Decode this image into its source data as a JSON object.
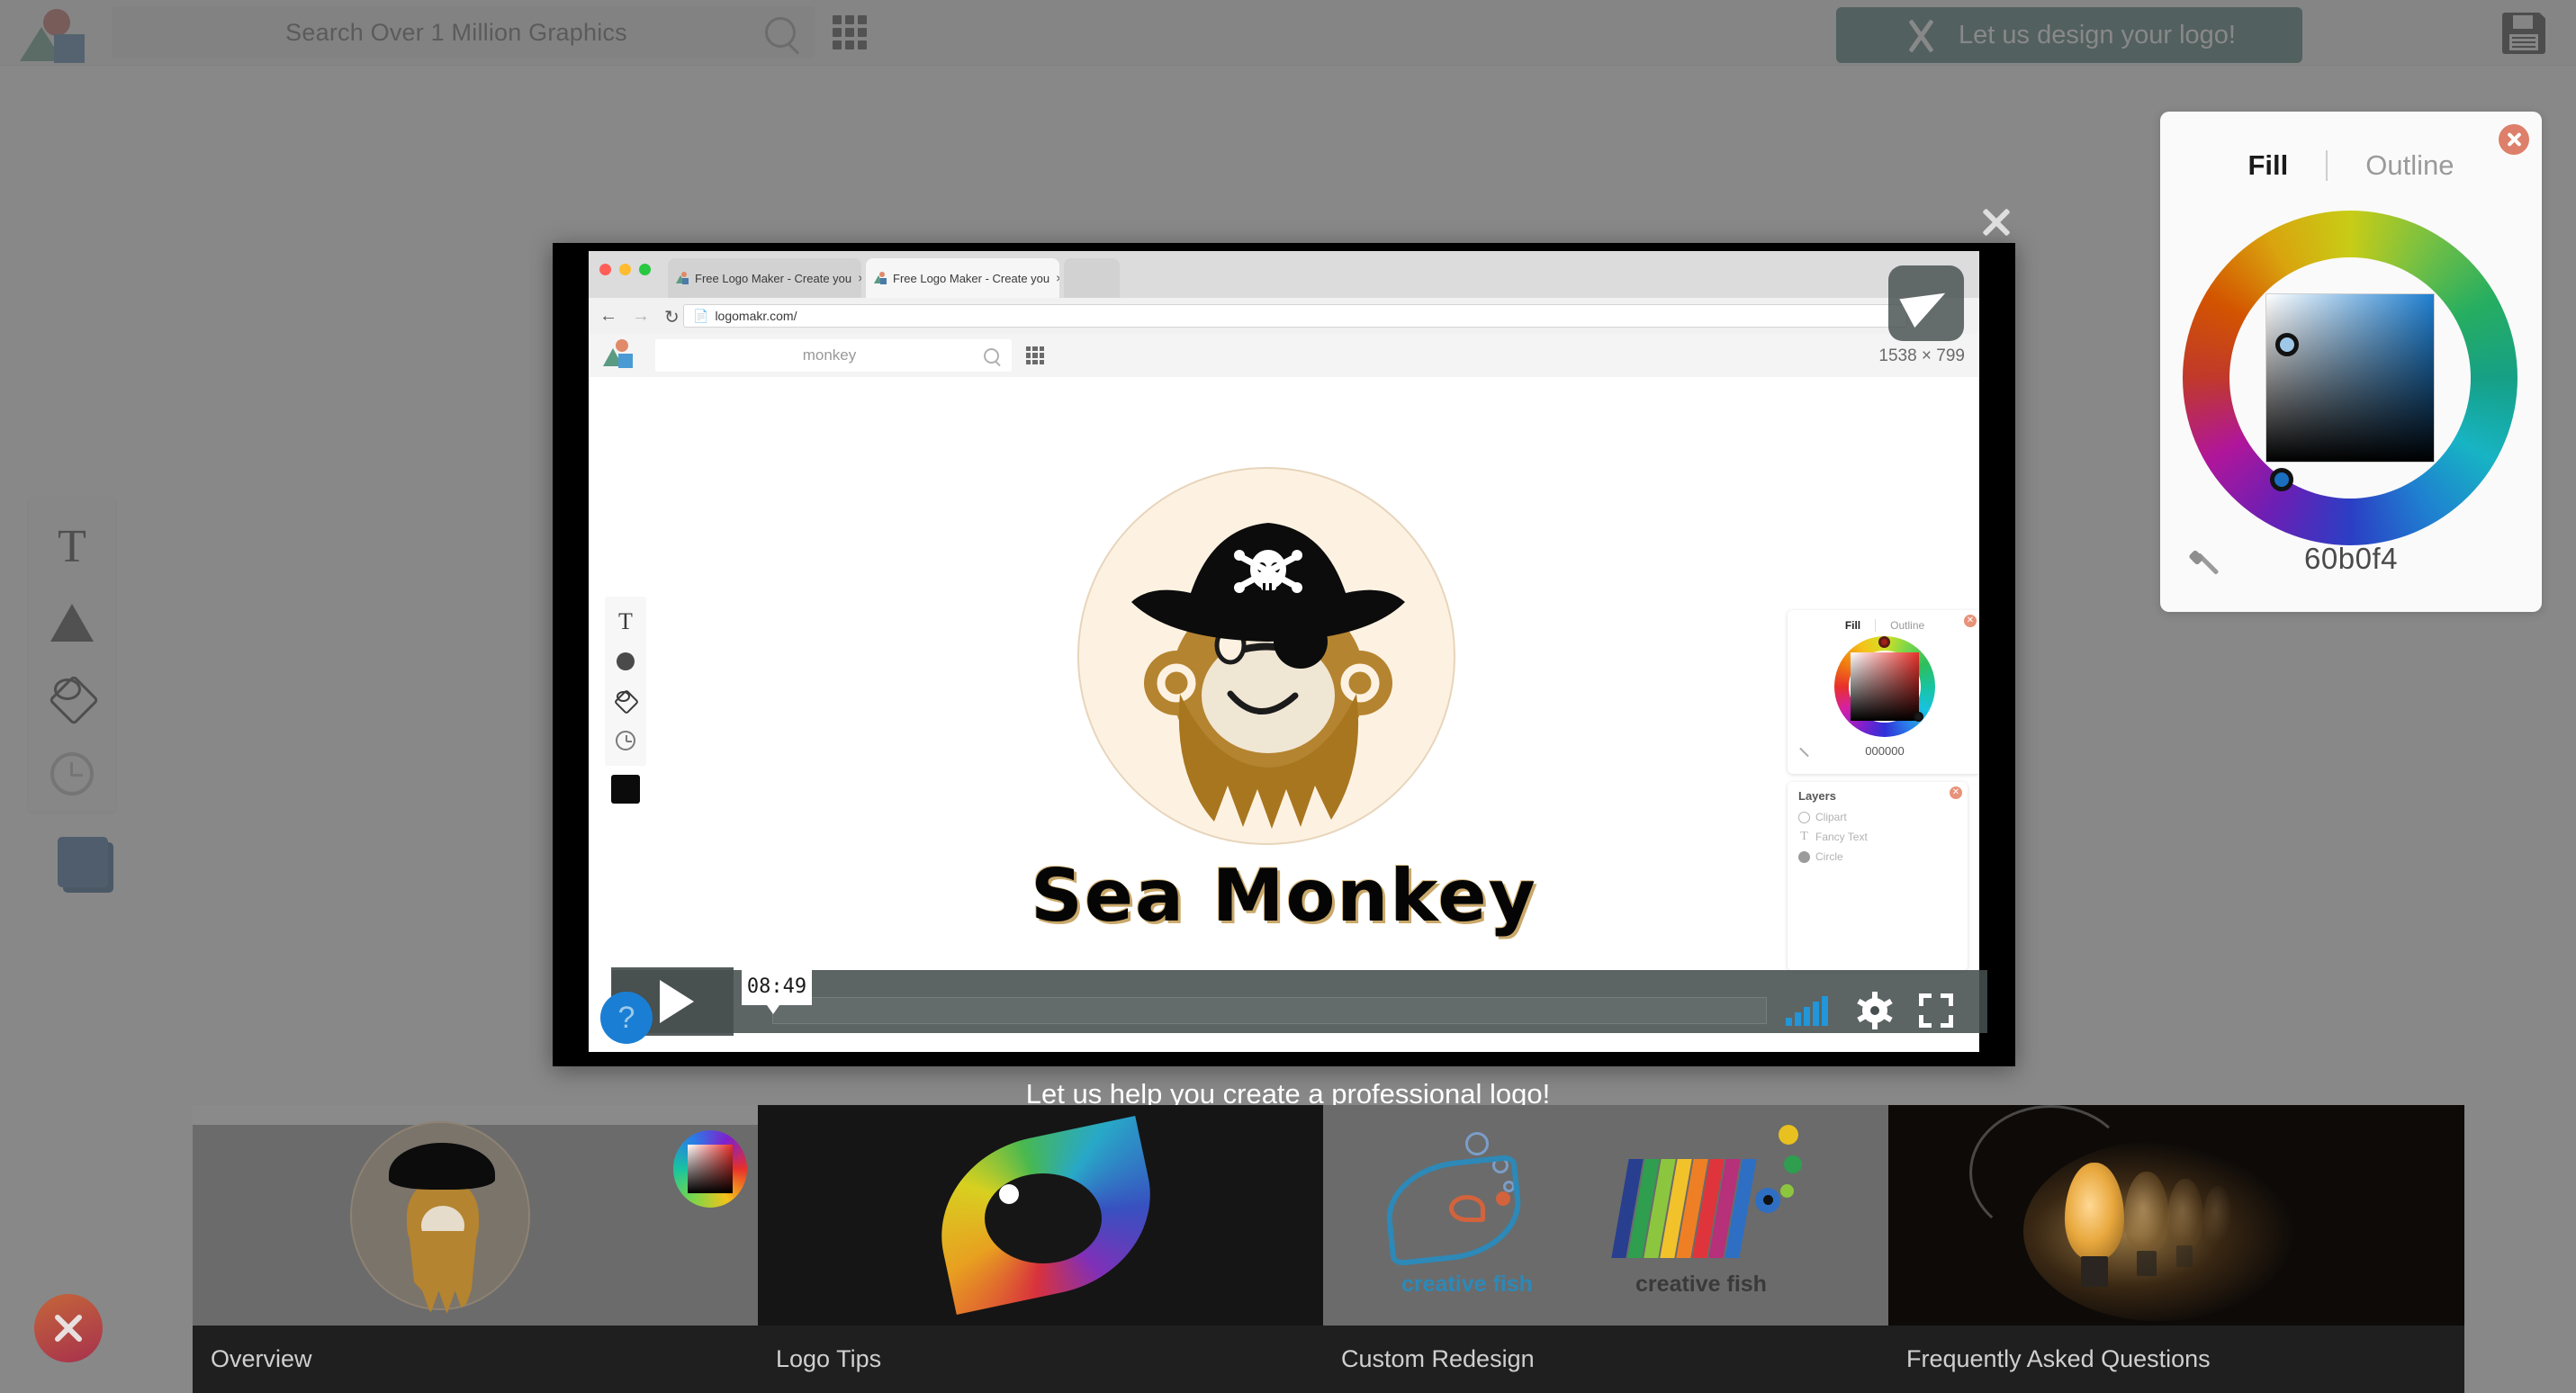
{
  "app": {
    "name": "Logo Maker"
  },
  "topbar": {
    "search_placeholder": "Search Over 1 Million Graphics",
    "search_value": "",
    "grid_icon": "grid-icon",
    "search_icon": "search-icon",
    "design_button_label": "Let us design your logo!",
    "design_button_icon": "pencil-icon",
    "design_button_color": "#3f6f6e",
    "save_icon": "save-floppy-icon",
    "logo_icon": "app-logo-shapes-icon"
  },
  "left_toolbar": {
    "items": [
      {
        "name": "text-tool",
        "icon": "text-T-icon",
        "label": "Text"
      },
      {
        "name": "shape-tool",
        "icon": "triangle-icon",
        "label": "Shape"
      },
      {
        "name": "clipart-tool",
        "icon": "clipart-icon",
        "label": "Clipart"
      },
      {
        "name": "history-tool",
        "icon": "history-clock-icon",
        "label": "History"
      }
    ],
    "swatch_color": "#336699"
  },
  "close_button": {
    "icon": "close-x-icon",
    "label": "Close"
  },
  "color_panel": {
    "tab_fill": "Fill",
    "tab_outline": "Outline",
    "active_tab": "Fill",
    "hex_value": "60b0f4",
    "close_icon": "close-circle-icon",
    "eyedropper_icon": "eyedropper-icon",
    "wheel_icon": "color-wheel",
    "selected_color": "#60b0f4"
  },
  "video_modal": {
    "close_icon": "close-x-icon",
    "send_icon": "paper-plane-icon",
    "browser": {
      "tabs": [
        {
          "title": "Free Logo Maker - Create you",
          "close": "×"
        },
        {
          "title": "Free Logo Maker - Create you",
          "close": "×"
        }
      ],
      "nav": {
        "back": "←",
        "forward": "→",
        "reload": "↻"
      },
      "url": "logomakr.com/",
      "url_icon": "page-icon",
      "traffic_lights": [
        "#ff5f57",
        "#febc2e",
        "#28c840"
      ]
    },
    "inner_app": {
      "search_value": "monkey",
      "search_icon": "search-icon",
      "grid_icon": "grid-icon",
      "canvas_dimensions": "1538 × 799",
      "logo_text": "Sea Monkey",
      "tools": [
        {
          "name": "text-tool",
          "icon": "text-T-icon"
        },
        {
          "name": "shape-tool",
          "icon": "circle-icon"
        },
        {
          "name": "clipart-tool",
          "icon": "clipart-icon"
        },
        {
          "name": "history-tool",
          "icon": "history-clock-icon"
        }
      ],
      "swatch_color": "#000000",
      "color_panel": {
        "tab_fill": "Fill",
        "tab_outline": "Outline",
        "hex_value": "000000",
        "close_icon": "close-circle-icon",
        "eyedropper_icon": "eyedropper-icon"
      },
      "layers_panel": {
        "title": "Layers",
        "close_icon": "close-circle-icon",
        "items": [
          {
            "label": "Clipart",
            "icon": "clipart-layer-icon"
          },
          {
            "label": "Fancy Text",
            "icon": "text-layer-icon"
          },
          {
            "label": "Circle",
            "icon": "circle-layer-icon"
          }
        ]
      }
    },
    "player": {
      "play_icon": "play-icon",
      "help_icon": "help-question-icon",
      "timestamp": "08:49",
      "volume_icon": "volume-bars-icon",
      "settings_icon": "gear-icon",
      "fullscreen_icon": "fullscreen-icon",
      "progress_percent": 0
    }
  },
  "promo": {
    "link_label": "Let us help you create a professional logo!"
  },
  "thumbnails": [
    {
      "label": "Overview",
      "name": "thumb-overview"
    },
    {
      "label": "Logo Tips",
      "name": "thumb-logo-tips"
    },
    {
      "label": "Custom Redesign",
      "name": "thumb-custom-redesign"
    },
    {
      "label": "Frequently Asked Questions",
      "name": "thumb-faq"
    }
  ]
}
